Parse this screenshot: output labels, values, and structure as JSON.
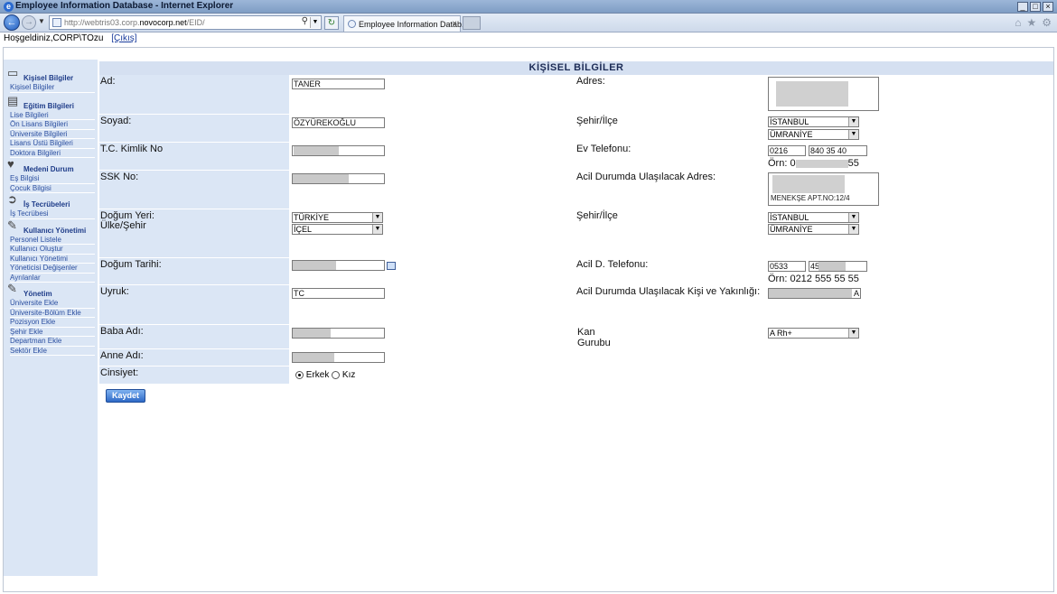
{
  "window": {
    "title": "Employee Information Database - Internet Explorer"
  },
  "browser": {
    "url_prefix": "http://webtris03.corp.",
    "url_domain": "novocorp.net",
    "url_suffix": "/EID/",
    "tab_label": "Employee Information Datab..."
  },
  "greeting": {
    "text": "Hoşgeldiniz,CORP\\TOzu",
    "logout": "[Çıkış]"
  },
  "sidebar": {
    "sections": [
      {
        "label": "Kişisel Bilgiler",
        "items": [
          "Kişisel Bilgiler"
        ]
      },
      {
        "label": "Eğitim Bilgileri",
        "items": [
          "Lise Bilgileri",
          "Ön Lisans Bilgileri",
          "Üniversite Bilgileri",
          "Lisans Üstü Bilgileri",
          "Doktora Bilgileri"
        ]
      },
      {
        "label": "Medeni Durum",
        "items": [
          "Eş Bilgisi",
          "Çocuk Bilgisi"
        ]
      },
      {
        "label": "İş Tecrübeleri",
        "items": [
          "İş Tecrübesi"
        ]
      },
      {
        "label": "Kullanıcı Yönetimi",
        "items": [
          "Personel Listele",
          "Kullanıcı Oluştur",
          "Kullanıcı Yönetimi",
          "Yöneticisi Değişenler",
          "Ayrılanlar"
        ]
      },
      {
        "label": "Yönetim",
        "items": [
          "Üniversite Ekle",
          "Üniversite-Bölüm Ekle",
          "Pozisyon Ekle",
          "Şehir Ekle",
          "Departman Ekle",
          "Sektör Ekle"
        ]
      }
    ]
  },
  "form": {
    "header": "KİŞİSEL BİLGİLER",
    "labels": {
      "ad": "Ad:",
      "soyad": "Soyad:",
      "tc": "T.C. Kimlik No",
      "ssk": "SSK No:",
      "dogum_yeri": "Doğum Yeri:",
      "ulke_sehir": "Ülke/Şehir",
      "dogum_tarihi": "Doğum Tarihi:",
      "uyruk": "Uyruk:",
      "baba": "Baba Adı:",
      "anne": "Anne Adı:",
      "cinsiyet": "Cinsiyet:",
      "adres": "Adres:",
      "sehir_ilce": "Şehir/İlçe",
      "ev_tel": "Ev Telefonu:",
      "acil_adres": "Acil Durumda Ulaşılacak Adres:",
      "sehir_ilce2": "Şehir/İlçe",
      "acil_tel": "Acil D. Telefonu:",
      "acil_kisi": "Acil Durumda Ulaşılacak Kişi ve Yakınlığı:",
      "kan_1": "Kan",
      "kan_2": "Gurubu"
    },
    "values": {
      "ad": "TANER",
      "soyad": "ÖZYÜREKOĞLU",
      "ulke": "TÜRKİYE",
      "dogum_sehir": "İÇEL",
      "uyruk": "TC",
      "adres_sehir": "İSTANBUL",
      "adres_ilce": "ÜMRANİYE",
      "ev_alan": "0216",
      "ev_no": "840 35 40",
      "ev_ornek": "Örn: 0",
      "ev_ornek_end": "55",
      "acil_adres_last": "MENEKŞE APT.NO:12/4",
      "acil_sehir": "İSTANBUL",
      "acil_ilce": "ÜMRANİYE",
      "acil_alan": "0533",
      "acil_no_start": "45",
      "acil_ornek": "Örn: 0212  555 55 55",
      "acil_kisi_end": "A",
      "kan": "A Rh+"
    },
    "gender": {
      "erkek": "Erkek",
      "kiz": "Kız",
      "selected": "Erkek"
    },
    "save": "Kaydet"
  }
}
